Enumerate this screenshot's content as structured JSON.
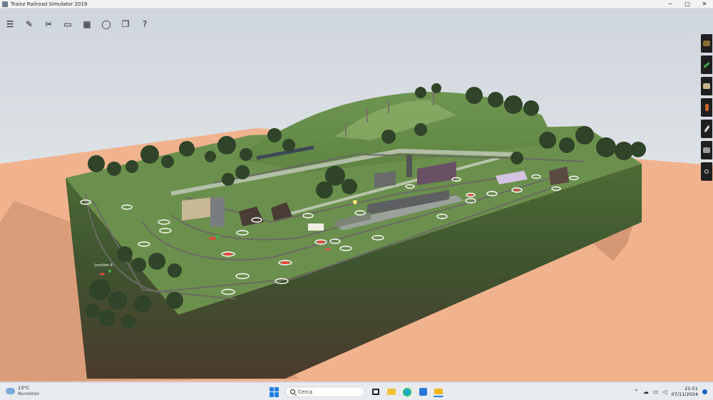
{
  "window": {
    "title": "Trainz Railroad Simulator 2019",
    "controls": {
      "minimize": "─",
      "maximize": "□",
      "close": "✕"
    }
  },
  "toolbar": {
    "items": [
      {
        "name": "menu-icon",
        "glyph": "☰"
      },
      {
        "name": "edit-tool-icon",
        "glyph": "✎"
      },
      {
        "name": "tools-icon",
        "glyph": "✂"
      },
      {
        "name": "monitor-icon",
        "glyph": "▭"
      },
      {
        "name": "briefcase-icon",
        "glyph": "▦"
      },
      {
        "name": "chat-icon",
        "glyph": "◯"
      },
      {
        "name": "layers-icon",
        "glyph": "❐"
      },
      {
        "name": "help-icon",
        "glyph": "?"
      }
    ]
  },
  "palette": {
    "items": [
      {
        "name": "terrain-palette-icon",
        "color": "#8b6f3a"
      },
      {
        "name": "track-palette-icon",
        "color": "#3fa64a"
      },
      {
        "name": "objects-palette-icon",
        "color": "#c9b48a"
      },
      {
        "name": "track-objects-palette-icon",
        "color": "#c9672a"
      },
      {
        "name": "wrench-palette-icon",
        "color": "#dcdcdc"
      },
      {
        "name": "layers-palette-icon",
        "color": "#9a9a9a"
      },
      {
        "name": "settings-palette-icon",
        "color": "#dcdcdc"
      }
    ]
  },
  "scene": {
    "junction_label": "Junction 8"
  },
  "taskbar": {
    "weather": {
      "temp": "13°C",
      "condition": "Nuvoloso"
    },
    "search_placeholder": "Cerca",
    "clock": {
      "time": "21:51",
      "date": "07/11/2024"
    }
  },
  "colors": {
    "ground": "#f3b48f",
    "sky": "#dfe4ea",
    "grass": "#6a8f4c",
    "accent": "#1e7fe0"
  }
}
